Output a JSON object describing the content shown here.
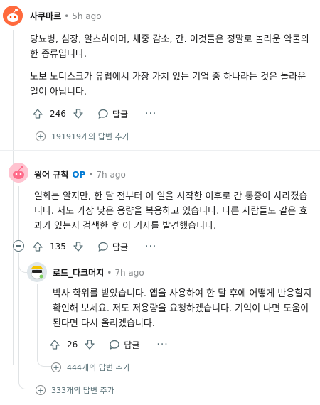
{
  "comments": [
    {
      "author": "사쿠마르",
      "op_badge": "",
      "time": "5h ago",
      "paragraphs": [
        "당뇨병, 심장, 알츠하이머, 체중 감소, 간. 이것들은 정말로 놀라운 약물의 한 종류입니다.",
        "노보 노디스크가 유럽에서 가장 가치 있는 기업 중 하나라는 것은 놀라운 일이 아닙니다."
      ],
      "votes": "246",
      "reply_label": "답글",
      "more_label": "···",
      "more_replies": "191919개의 답변 추가"
    },
    {
      "author": "윙어 규칙",
      "op_badge": "OP",
      "time": "7h ago",
      "paragraphs": [
        "일화는 알지만, 한 달 전부터 이 일을 시작한 이후로 간 통증이 사라졌습니다. 저도 가장 낮은 용량을 복용하고 있습니다. 다른 사람들도 같은 효과가 있는지 검색한 후 이 기사를 발견했습니다."
      ],
      "votes": "135",
      "reply_label": "답글",
      "more_label": "···",
      "more_replies": "333개의 답변 추가"
    },
    {
      "author": "로드_다크머지",
      "op_badge": "",
      "time": "7h ago",
      "paragraphs": [
        "박사 학위를 받았습니다. 앱을 사용하여 한 달 후에 어떻게 반응할지 확인해 보세요. 저도 저용량을 요청하겠습니다. 기억이 나면 도움이 된다면 다시 올리겠습니다."
      ],
      "votes": "26",
      "reply_label": "답글",
      "more_label": "···",
      "more_replies": "444개의 답변 추가"
    }
  ],
  "colors": {
    "op": "#0079d3",
    "meta": "#878a8c",
    "icon": "#576f76",
    "thread": "#e0e3e5",
    "avatar1": "#ff6a3d",
    "avatar2": "#ff6b8a"
  },
  "icons": [
    "upvote-icon",
    "downvote-icon",
    "reply-bubble-icon",
    "more-options-icon",
    "plus-icon",
    "collapse-icon"
  ]
}
